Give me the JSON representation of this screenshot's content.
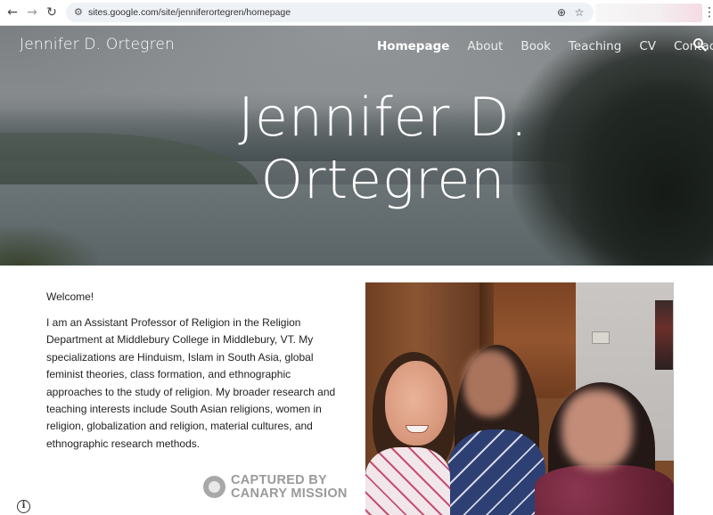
{
  "browser": {
    "back_icon": "←",
    "forward_icon": "→",
    "reload_icon": "↻",
    "site_info_icon": "tune-icon",
    "url": "sites.google.com/site/jenniferortegren/homepage",
    "zoom_icon": "zoom-icon",
    "star_icon": "star-icon",
    "menu_icon": "⋮"
  },
  "site": {
    "title": "Jennifer D. Ortegren",
    "nav": {
      "homepage": "Homepage",
      "about": "About",
      "book": "Book",
      "teaching": "Teaching",
      "cv": "CV",
      "contact": "Contact"
    },
    "active_nav": "Homepage",
    "hero_heading": "Jennifer D. Ortegren"
  },
  "content": {
    "welcome": "Welcome!",
    "bio": "I am an Assistant Professor of Religion in the Religion Department at Middlebury College in Middlebury, VT. My specializations are Hinduism, Islam in South Asia, global feminist theories, class formation, and ethnographic approaches to the study of religion. My broader research and teaching interests include South Asian religions, women in religion, globalization and religion, material cultures, and ethnographic research methods."
  },
  "watermark": {
    "line1": "CAPTURED BY",
    "line2": "CANARY MISSION"
  },
  "info_button": "i"
}
